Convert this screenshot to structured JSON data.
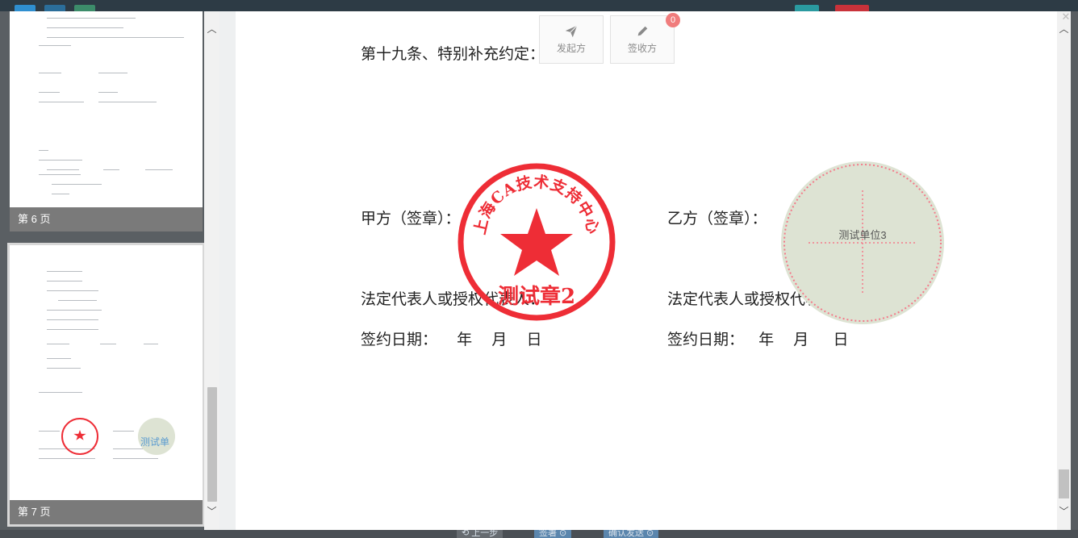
{
  "thumbnails": [
    {
      "label": "第 6 页"
    },
    {
      "label": "第 7 页",
      "mini_stamp_b_text": "测试单"
    }
  ],
  "toolbar": {
    "sender_label": "发起方",
    "receiver_label": "签收方",
    "receiver_badge": "0"
  },
  "document": {
    "article_title": "第十九条、特别补充约定：",
    "party_a_seal": "甲方（签章）：",
    "party_b_seal": "乙方（签章）：",
    "party_a_rep": "法定代表人或授权代表人：",
    "party_b_rep": "法定代表人或授权代表人：",
    "party_a_date": "签约日期：    年    月    日",
    "party_b_date": "签约日期：   年    月     日"
  },
  "stamps": {
    "red_seal_ring_text": "上海CA技术支持中心",
    "red_seal_center_text": "测试章2",
    "pending_seal_text": "测试单位3"
  },
  "bottom_bar": {
    "prev_label": "上一步",
    "sign_label": "签署",
    "confirm_label": "确认发送"
  },
  "colors": {
    "seal_red": "#ee2d36",
    "pending_seal_fill": "#dde3d3",
    "badge": "#f07c7c"
  }
}
